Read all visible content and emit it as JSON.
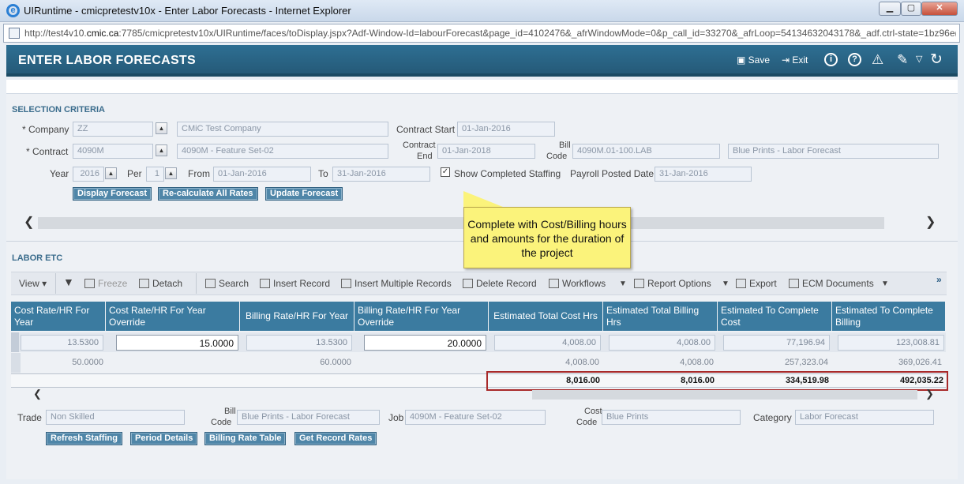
{
  "window": {
    "title": "UIRuntime - cmicpretestv10x - Enter Labor Forecasts - Internet Explorer",
    "url_pre": "http://test4v10.",
    "url_host": "cmic.ca",
    "url_post": ":7785/cmicpretestv10x/UIRuntime/faces/toDisplay.jspx?Adf-Window-Id=labourForecast&page_id=4102476&_afrWindowMode=0&p_call_id=33270&_afrLoop=54134632043178&_adf.ctrl-state=1bz96e("
  },
  "header": {
    "title": "ENTER LABOR FORECASTS",
    "save": "Save",
    "exit": "Exit"
  },
  "selection": {
    "heading": "SELECTION CRITERIA",
    "company_label": "* Company",
    "company_code": "ZZ",
    "company_name": "CMiC Test Company",
    "contract_start_label": "Contract Start",
    "contract_start": "01-Jan-2016",
    "contract_label": "* Contract",
    "contract_code": "4090M",
    "contract_name": "4090M - Feature Set-02",
    "contract_end_label1": "Contract",
    "contract_end_label2": "End",
    "contract_end": "01-Jan-2018",
    "bill_code_label1": "Bill",
    "bill_code_label2": "Code",
    "bill_code": "4090M.01-100.LAB",
    "bill_code_desc": "Blue Prints - Labor Forecast",
    "year_label": "Year",
    "year": "2016",
    "per_label": "Per",
    "per": "1",
    "from_label": "From",
    "from": "01-Jan-2016",
    "to_label": "To",
    "to": "31-Jan-2016",
    "show_completed": "Show Completed Staffing",
    "payroll_label": "Payroll Posted Date",
    "payroll_date": "31-Jan-2016",
    "buttons": [
      "Display Forecast",
      "Re-calculate All Rates",
      "Update Forecast"
    ]
  },
  "callout": "Complete with Cost/Billing hours and amounts for the duration of the project",
  "labor": {
    "heading": "LABOR ETC",
    "toolbar": {
      "view": "View",
      "freeze": "Freeze",
      "detach": "Detach",
      "search": "Search",
      "insert": "Insert Record",
      "insert_multi": "Insert Multiple Records",
      "delete": "Delete Record",
      "workflows": "Workflows",
      "report": "Report Options",
      "export": "Export",
      "ecm": "ECM Documents"
    },
    "columns": [
      "Cost Rate/HR For Year",
      "Cost Rate/HR For Year Override",
      "Billing Rate/HR For Year",
      "Billing Rate/HR For Year Override",
      "Estimated Total Cost Hrs",
      "Estimated Total Billing Hrs",
      "Estimated To Complete Cost",
      "Estimated To Complete Billing"
    ],
    "row": [
      "13.5300",
      "15.0000",
      "13.5300",
      "20.0000",
      "4,008.00",
      "4,008.00",
      "77,196.94",
      "123,008.81"
    ],
    "summary": [
      "50.0000",
      "60.0000",
      "4,008.00",
      "4,008.00",
      "257,323.04",
      "369,026.41"
    ],
    "totals": [
      "8,016.00",
      "8,016.00",
      "334,519.98",
      "492,035.22"
    ]
  },
  "detail": {
    "trade_label": "Trade",
    "trade": "Non Skilled",
    "bill_code_label1": "Bill",
    "bill_code_label2": "Code",
    "bill_code": "Blue Prints - Labor Forecast",
    "job_label": "Job",
    "job": "4090M - Feature Set-02",
    "cost_code_label1": "Cost",
    "cost_code_label2": "Code",
    "cost_code": "Blue Prints",
    "category_label": "Category",
    "category": "Labor Forecast",
    "buttons": [
      "Refresh Staffing",
      "Period Details",
      "Billing Rate Table",
      "Get Record Rates"
    ]
  }
}
